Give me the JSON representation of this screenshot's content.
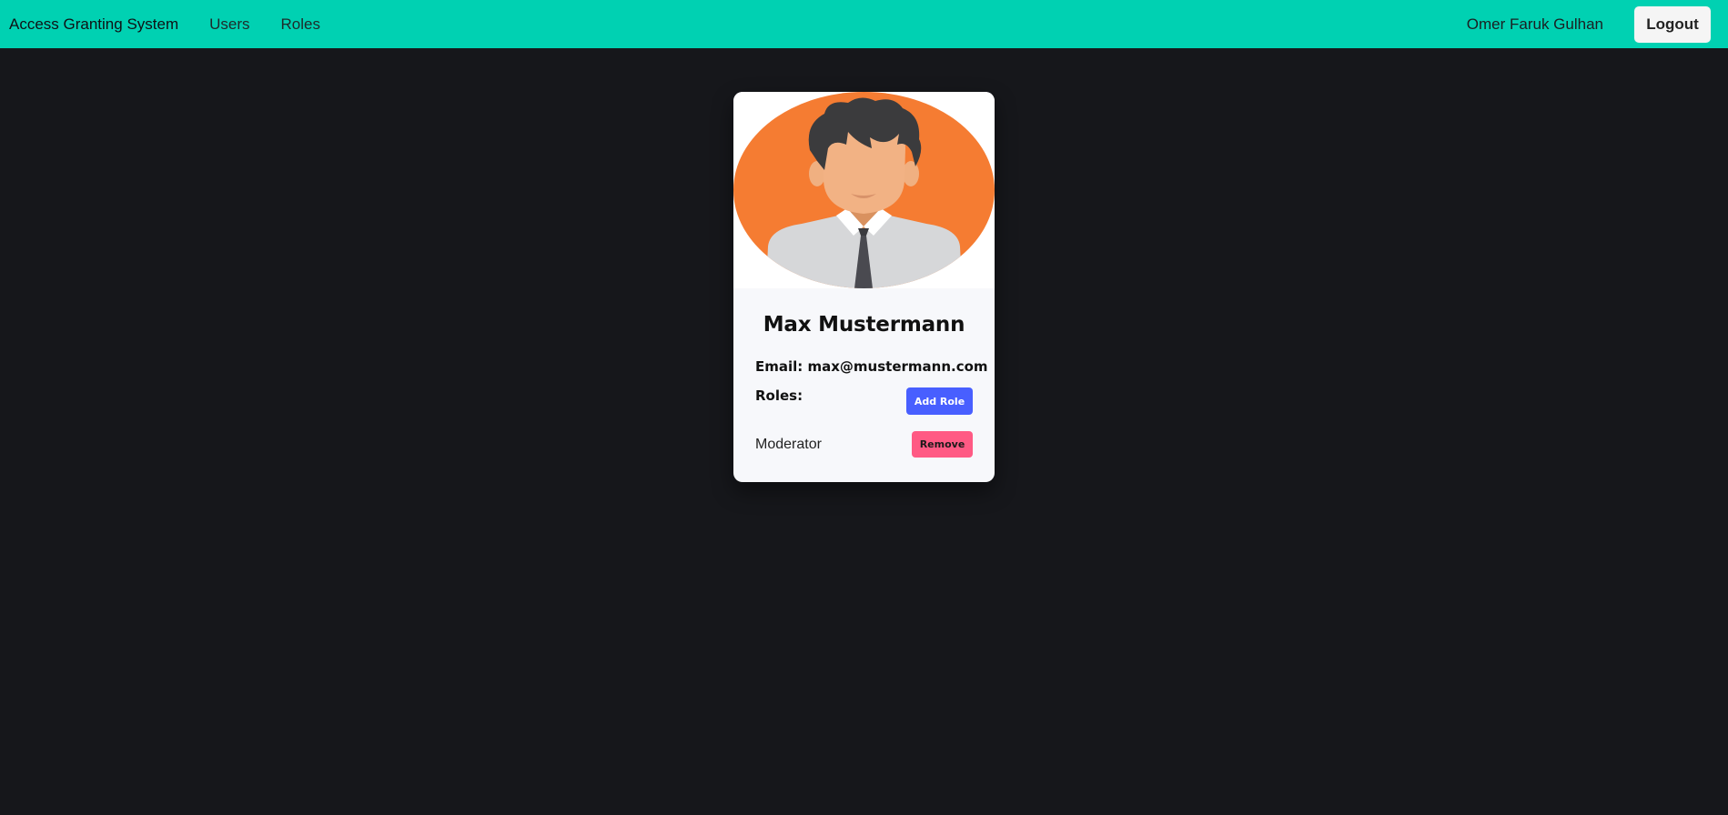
{
  "navbar": {
    "brand": "Access Granting System",
    "links": [
      "Users",
      "Roles"
    ],
    "username": "Omer Faruk Gulhan",
    "logout_label": "Logout",
    "color": "#00d1b2"
  },
  "profile": {
    "name": "Max Mustermann",
    "email_line": "Email: max@mustermann.com",
    "roles_label": "Roles:",
    "add_role_label": "Add Role",
    "roles": [
      {
        "name": "Moderator",
        "remove_label": "Remove"
      }
    ],
    "avatar_icon": "avatar-icon",
    "colors": {
      "avatar_background": "#f57c32",
      "add_role_button": "#485fff",
      "remove_button": "#ff5a84"
    }
  }
}
